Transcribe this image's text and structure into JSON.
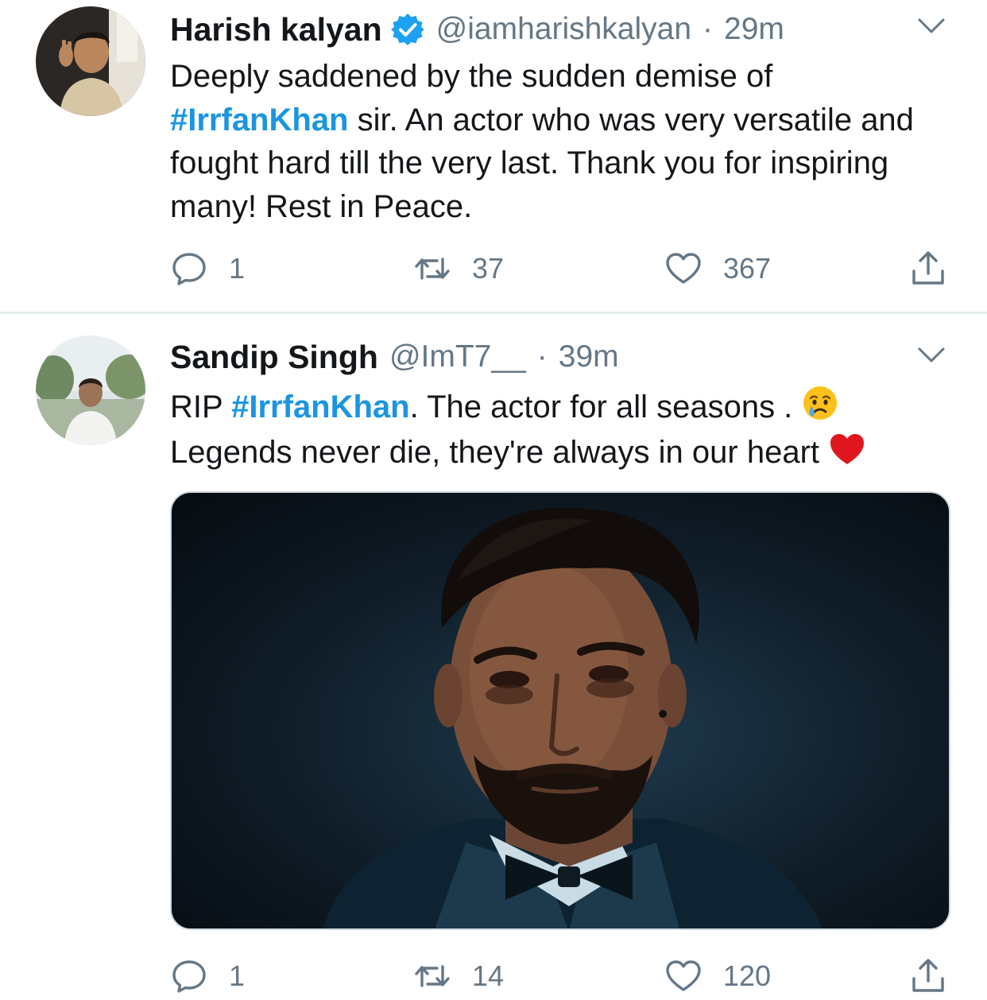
{
  "tweets": [
    {
      "name": "Harish kalyan",
      "verified": true,
      "handle": "@iamharishkalyan",
      "separator": "·",
      "time": "29m",
      "text_parts": [
        "Deeply saddened by the sudden demise of ",
        "#IrrfanKhan",
        " sir. An actor who was very versatile and fought hard till the very last. Thank you for inspiring many! Rest in Peace."
      ],
      "replies": "1",
      "retweets": "37",
      "likes": "367"
    },
    {
      "name": "Sandip Singh",
      "verified": false,
      "handle": "@ImT7__",
      "separator": "·",
      "time": "39m",
      "text_parts": [
        "RIP ",
        "#IrrfanKhan",
        ". The actor for all seasons .",
        "Legends never die, they're always in our heart"
      ],
      "emojis": [
        "crying-face",
        "red-heart"
      ],
      "has_media": true,
      "replies": "1",
      "retweets": "14",
      "likes": "120"
    }
  ],
  "colors": {
    "hashtag": "#1b95e0",
    "secondary_text": "#657786",
    "verified_badge": "#1da1f2",
    "divider": "#e6ecf0"
  },
  "icons": [
    "chevron-down-icon",
    "verified-badge-icon",
    "reply-icon",
    "retweet-icon",
    "like-icon",
    "share-icon"
  ]
}
